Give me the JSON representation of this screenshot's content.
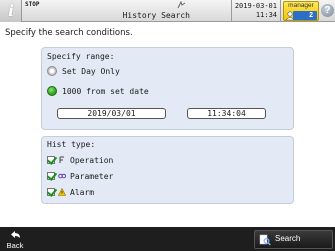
{
  "topbar": {
    "status": "STOP",
    "title": "History Search",
    "date": "2019-03-01",
    "time": "11:34",
    "user_name": "manager",
    "user_level": "2"
  },
  "main": {
    "prompt": "Specify the search conditions.",
    "range": {
      "title": "Specify range:",
      "options": [
        {
          "label": "Set Day Only",
          "selected": false
        },
        {
          "label": "1000 from set date",
          "selected": true
        }
      ],
      "date_value": "2019/03/01",
      "time_value": "11:34:04"
    },
    "hist_type": {
      "title": "Hist type:",
      "items": [
        {
          "label": "Operation",
          "checked": true,
          "icon": "operation-icon"
        },
        {
          "label": "Parameter",
          "checked": true,
          "icon": "parameter-icon"
        },
        {
          "label": "Alarm",
          "checked": true,
          "icon": "alarm-icon"
        }
      ]
    }
  },
  "bottombar": {
    "back_label": "Back",
    "search_label": "Search"
  },
  "colors": {
    "panel_bg": "#e4eaf5",
    "user_box": "#f1c400",
    "user_level": "#2c6fc6",
    "radio_on": "#2fa81f",
    "check": "#1b8e1b",
    "bottom_bar": "#1e1e1e"
  }
}
